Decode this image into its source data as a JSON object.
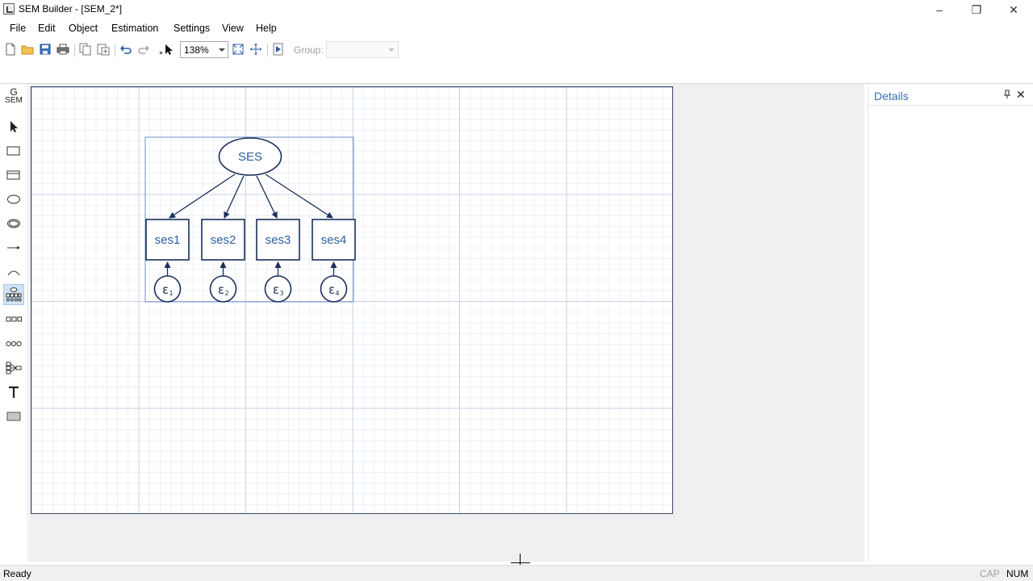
{
  "window": {
    "title": "SEM Builder - [SEM_2*]",
    "minimize": "–",
    "maximize": "❐",
    "close": "✕"
  },
  "menu": [
    "File",
    "Edit",
    "Object",
    "Estimation",
    "Settings",
    "View",
    "Help"
  ],
  "toolbar": {
    "zoom_value": "138%",
    "group_label": "Group:",
    "group_value": "",
    "icons": [
      "new-file-icon",
      "open-folder-icon",
      "save-icon",
      "print-icon",
      "copy-icon",
      "paste-icon",
      "undo-icon",
      "redo-icon",
      "select-cursor-icon",
      "fit-zoom-icon",
      "pan-move-icon",
      "estimate-run-icon"
    ]
  },
  "palette": {
    "gsem_label_top": "G",
    "gsem_label_bottom": "SEM",
    "tools": [
      "select-tool",
      "observed-variable-tool",
      "generalized-response-tool",
      "latent-variable-tool",
      "multilevel-latent-tool",
      "path-tool",
      "covariance-tool",
      "measurement-component-tool",
      "observed-set-tool",
      "latent-set-tool",
      "regression-component-tool",
      "text-tool",
      "area-tool"
    ],
    "active_tool": "measurement-component-tool"
  },
  "diagram": {
    "latent": "SES",
    "observed": [
      "ses1",
      "ses2",
      "ses3",
      "ses4"
    ],
    "errors": [
      {
        "symbol": "ε",
        "sub": "1"
      },
      {
        "symbol": "ε",
        "sub": "2"
      },
      {
        "symbol": "ε",
        "sub": "3"
      },
      {
        "symbol": "ε",
        "sub": "4"
      }
    ],
    "color": "#1a2f5a",
    "text_color": "#2e5fa0"
  },
  "details": {
    "title": "Details"
  },
  "status": {
    "text": "Ready",
    "cap": "CAP",
    "num": "NUM"
  }
}
